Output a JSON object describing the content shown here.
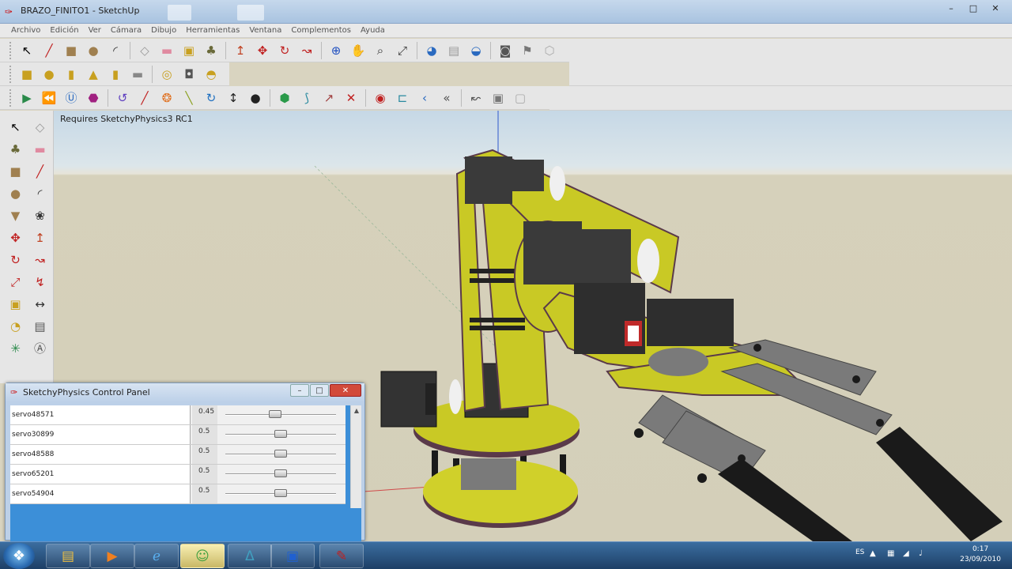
{
  "window": {
    "title": "BRAZO_FINITO1 - SketchUp",
    "controls": {
      "minimize": "–",
      "maximize": "□",
      "close": "✕"
    }
  },
  "menu": [
    "Archivo",
    "Edición",
    "Ver",
    "Cámara",
    "Dibujo",
    "Herramientas",
    "Ventana",
    "Complementos",
    "Ayuda"
  ],
  "toolbars": {
    "row1": [
      "select-icon",
      "line-icon",
      "rectangle-icon",
      "circle-icon",
      "arc-icon",
      "|",
      "make-component-icon",
      "eraser-icon",
      "tape-measure-icon",
      "paint-bucket-icon",
      "|",
      "push-pull-icon",
      "move-icon",
      "rotate-icon",
      "follow-me-icon",
      "|",
      "orbit-icon",
      "pan-icon",
      "zoom-icon",
      "zoom-extents-icon",
      "|",
      "get-models-icon",
      "share-model-icon",
      "get-photo-texture-icon",
      "|",
      "physics-cube-icon",
      "physics-lamp-icon",
      "physics-sphere-icon"
    ],
    "row2": [
      "box-icon",
      "sphere-icon",
      "cylinder-icon",
      "cone-icon",
      "capsule-icon",
      "plate-icon",
      "|",
      "torus-icon",
      "chamfer-box-icon",
      "ball-joint-icon"
    ],
    "row3": [
      "play-icon",
      "rewind-icon",
      "ui-icon",
      "record-icon",
      "|",
      "hinge-icon",
      "slider-joint-icon",
      "servo-icon",
      "piston-icon",
      "spring-icon",
      "motor-icon",
      "magnet-icon",
      "|",
      "gyro-icon",
      "gear-joint-icon",
      "thruster-icon",
      "fixed-joint-icon",
      "|",
      "emitter-icon",
      "curvy-slider-icon",
      "joint-connect-icon",
      "back-icon",
      "|",
      "clear-joints-icon",
      "show-joints-icon",
      "hide-joints-icon"
    ]
  },
  "left_palette": [
    "select-icon",
    "make-component-icon",
    "paint-bucket-icon",
    "eraser-icon",
    "rectangle-icon",
    "line-icon",
    "circle-icon",
    "arc-icon",
    "polygon-icon",
    "freehand-icon",
    "move-icon",
    "push-pull-icon",
    "rotate-icon",
    "follow-me-icon",
    "scale-icon",
    "offset-icon",
    "tape-measure-icon",
    "dimension-icon",
    "protractor-icon",
    "text-icon",
    "axes-icon",
    "3d-text-icon"
  ],
  "viewport": {
    "note": "Requires SketchyPhysics3 RC1"
  },
  "control_panel": {
    "title": "SketchyPhysics Control Panel",
    "rows": [
      {
        "name": "servo48571",
        "value": "0.45",
        "position": 0.45
      },
      {
        "name": "servo30899",
        "value": "0.5",
        "position": 0.5
      },
      {
        "name": "servo48588",
        "value": "0.5",
        "position": 0.5
      },
      {
        "name": "servo65201",
        "value": "0.5",
        "position": 0.5
      },
      {
        "name": "servo54904",
        "value": "0.5",
        "position": 0.5
      }
    ]
  },
  "taskbar": {
    "apps": [
      "windows-explorer-icon",
      "media-player-icon",
      "internet-explorer-icon",
      "windows-live-messenger-icon",
      "arduino-icon",
      "vs-icon",
      "sketchup-icon"
    ],
    "tray": {
      "language": "ES",
      "time": "0:17",
      "date": "23/09/2010"
    }
  }
}
